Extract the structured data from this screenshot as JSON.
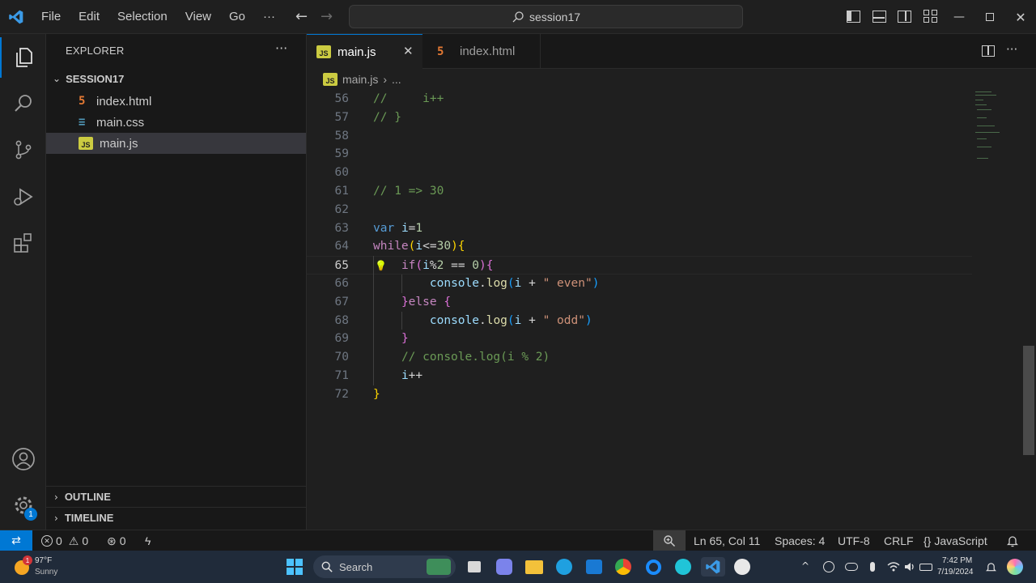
{
  "titlebar": {
    "menu": [
      "File",
      "Edit",
      "Selection",
      "View",
      "Go",
      "···"
    ],
    "search": "session17"
  },
  "sidebar": {
    "title": "EXPLORER",
    "more": "···",
    "folder": "SESSION17",
    "files": [
      {
        "name": "index.html",
        "type": "html"
      },
      {
        "name": "main.css",
        "type": "css"
      },
      {
        "name": "main.js",
        "type": "js"
      }
    ],
    "outline": "OUTLINE",
    "timeline": "TIMELINE",
    "settings_badge": "1"
  },
  "tabs": [
    {
      "label": "main.js",
      "active": true
    },
    {
      "label": "index.html",
      "active": false
    }
  ],
  "breadcrumb": {
    "file": "main.js",
    "rest": "..."
  },
  "code": {
    "current_line": 65,
    "lines": [
      {
        "n": "56",
        "text": "//     i++"
      },
      {
        "n": "57",
        "text": "// }"
      },
      {
        "n": "58",
        "text": ""
      },
      {
        "n": "59",
        "text": ""
      },
      {
        "n": "60",
        "text": ""
      },
      {
        "n": "61",
        "text": "// 1 => 30"
      },
      {
        "n": "62",
        "text": ""
      },
      {
        "n": "63",
        "text": "var i=1"
      },
      {
        "n": "64",
        "text": "while(i<=30){"
      },
      {
        "n": "65",
        "text": "    if(i%2 == 0){"
      },
      {
        "n": "66",
        "text": "        console.log(i + \" even\")"
      },
      {
        "n": "67",
        "text": "    }else {"
      },
      {
        "n": "68",
        "text": "        console.log(i + \" odd\")"
      },
      {
        "n": "69",
        "text": "    }"
      },
      {
        "n": "70",
        "text": "    // console.log(i % 2)"
      },
      {
        "n": "71",
        "text": "    i++"
      },
      {
        "n": "72",
        "text": "}"
      }
    ]
  },
  "statusbar": {
    "errors": "0",
    "warnings": "0",
    "ports": "0",
    "position": "Ln 65, Col 11",
    "spaces": "Spaces: 4",
    "encoding": "UTF-8",
    "eol": "CRLF",
    "language": "JavaScript"
  },
  "taskbar": {
    "weather_temp": "97°F",
    "weather_desc": "Sunny",
    "weather_badge": "1",
    "search": "Search",
    "time": "7:42 PM",
    "date": "7/19/2024"
  },
  "colors": {
    "accent": "#0078d4",
    "editor_bg": "#1f1f1f",
    "sidebar_bg": "#181818",
    "taskbar_bg": "#202b3a"
  }
}
